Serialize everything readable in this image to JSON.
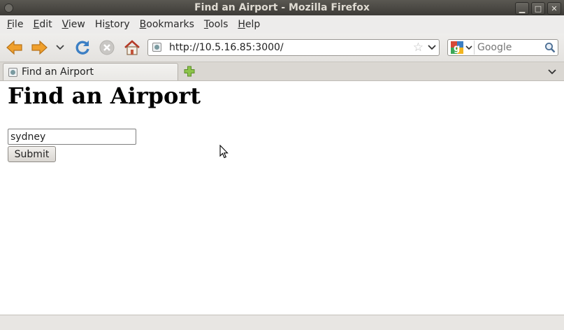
{
  "window": {
    "title": "Find an Airport - Mozilla Firefox",
    "minimize_glyph": "▁",
    "maximize_glyph": "□",
    "close_glyph": "✕"
  },
  "menu": {
    "items": [
      {
        "accel": "F",
        "rest": "ile"
      },
      {
        "accel": "E",
        "rest": "dit"
      },
      {
        "accel": "V",
        "rest": "iew"
      },
      {
        "pre": "Hi",
        "accel": "s",
        "rest": "tory"
      },
      {
        "accel": "B",
        "rest": "ookmarks"
      },
      {
        "accel": "T",
        "rest": "ools"
      },
      {
        "accel": "H",
        "rest": "elp"
      }
    ]
  },
  "navbar": {
    "url": "http://10.5.16.85:3000/",
    "search_placeholder": "Google",
    "icons": [
      "back-arrow-icon",
      "forward-arrow-icon",
      "history-dropdown-icon",
      "reload-icon",
      "stop-icon",
      "home-icon",
      "bookmark-star-icon",
      "google-icon",
      "magnifier-icon"
    ]
  },
  "tabs": [
    {
      "label": "Find an Airport"
    }
  ],
  "page": {
    "heading": "Find an Airport",
    "query_value": "sydney",
    "submit_label": "Submit"
  },
  "colors": {
    "titlebar": "#3d3b37",
    "chrome": "#edeceb",
    "accent_blue": "#3c7fc4",
    "arrow_orange": "#f0a02c"
  }
}
